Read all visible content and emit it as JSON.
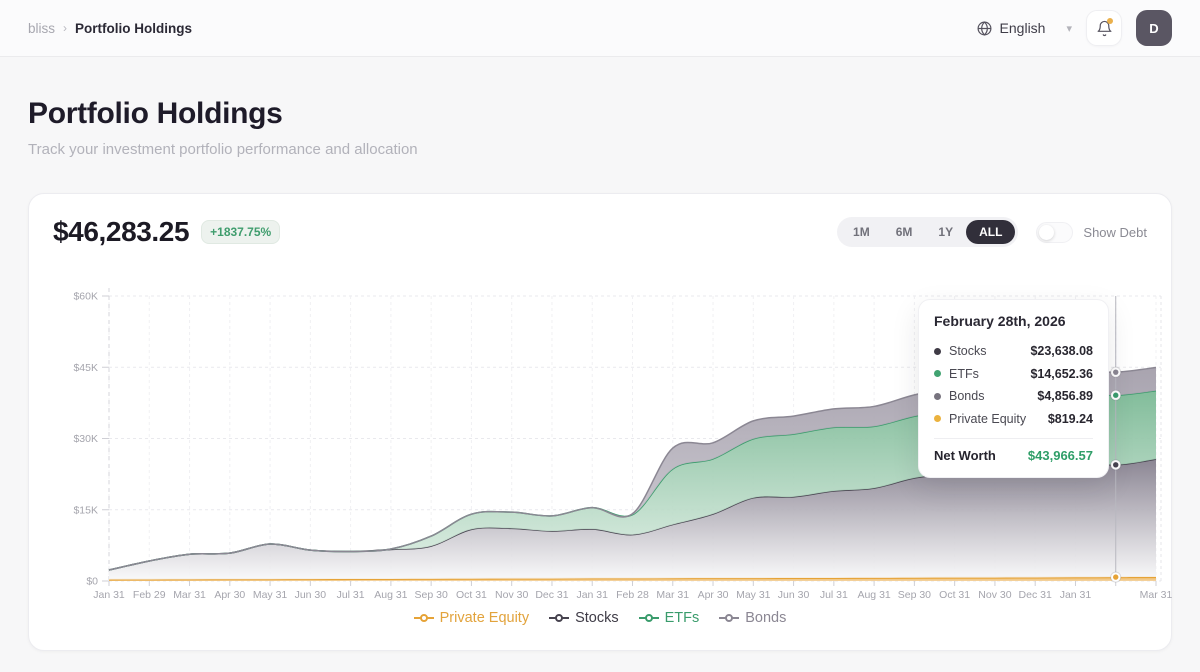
{
  "topbar": {
    "breadcrumb": {
      "root": "bliss",
      "separator": "›",
      "current": "Portfolio Holdings"
    },
    "language": "English",
    "avatar_initial": "D"
  },
  "page": {
    "title": "Portfolio Holdings",
    "subtitle": "Track your investment portfolio performance and allocation"
  },
  "card": {
    "net_worth": "$46,283.25",
    "change_badge": "+1837.75%",
    "ranges": [
      "1M",
      "6M",
      "1Y",
      "ALL"
    ],
    "active_range": "ALL",
    "show_debt_label": "Show Debt"
  },
  "tooltip": {
    "title": "February 28th, 2026",
    "rows": [
      {
        "label": "Stocks",
        "value": "$23,638.08",
        "color": "#3f3b46"
      },
      {
        "label": "ETFs",
        "value": "$14,652.36",
        "color": "#41a371"
      },
      {
        "label": "Bonds",
        "value": "$4,856.89",
        "color": "#77737e"
      },
      {
        "label": "Private Equity",
        "value": "$819.24",
        "color": "#ebb23e"
      }
    ],
    "net_worth_label": "Net Worth",
    "net_worth_value": "$43,966.57"
  },
  "chart_data": {
    "type": "area",
    "stacked": true,
    "x_labels": [
      "Jan 31",
      "Feb 29",
      "Mar 31",
      "Apr 30",
      "May 31",
      "Jun 30",
      "Jul 31",
      "Aug 31",
      "Sep 30",
      "Oct 31",
      "Nov 30",
      "Dec 31",
      "Jan 31",
      "Feb 28",
      "Mar 31",
      "Apr 30",
      "May 31",
      "Jun 30",
      "Jul 31",
      "Aug 31",
      "Sep 30",
      "Oct 31",
      "Nov 30",
      "Dec 31",
      "Jan 31",
      "Feb 28",
      "Mar 31"
    ],
    "hidden_x_label_index": 25,
    "highlight_index": 25,
    "ylim": [
      0,
      60000
    ],
    "y_ticks": [
      {
        "value": 0,
        "label": "$0"
      },
      {
        "value": 15000,
        "label": "$15K"
      },
      {
        "value": 30000,
        "label": "$30K"
      },
      {
        "value": 45000,
        "label": "$45K"
      },
      {
        "value": 60000,
        "label": "$60K"
      }
    ],
    "grid": true,
    "legend_position": "bottom",
    "series": [
      {
        "key": "private_equity",
        "name": "Private Equity",
        "stroke": "#e6a337",
        "fill_top": "#ecb254",
        "fill_bottom": "#f3cf97",
        "text_color": "#e2a33c",
        "values": [
          300,
          320,
          340,
          360,
          380,
          400,
          410,
          430,
          450,
          470,
          490,
          510,
          540,
          550,
          580,
          600,
          610,
          620,
          640,
          650,
          680,
          700,
          720,
          750,
          780,
          819.24,
          850
        ]
      },
      {
        "key": "stocks",
        "name": "Stocks",
        "stroke": "#47434f",
        "fill_top": "#847e8d",
        "fill_bottom": "#f8f8f9",
        "text_color": "#3f3c47",
        "values": [
          2000,
          3900,
          5300,
          5500,
          7400,
          6100,
          5800,
          6200,
          6900,
          10400,
          10600,
          10000,
          10400,
          9200,
          11300,
          13500,
          16900,
          17100,
          18300,
          18900,
          21000,
          22000,
          23300,
          25000,
          24500,
          23638.08,
          24800
        ]
      },
      {
        "key": "etfs",
        "name": "ETFs",
        "stroke": "#3a9c6c",
        "fill_top": "#7bb995",
        "fill_bottom": "#dcede2",
        "text_color": "#3a9c6c",
        "values": [
          0,
          0,
          0,
          0,
          0,
          0,
          0,
          100,
          2100,
          3200,
          3400,
          3200,
          4500,
          4200,
          11700,
          11600,
          12400,
          13200,
          13400,
          13000,
          13000,
          13500,
          13800,
          13600,
          14200,
          14652.36,
          14400
        ]
      },
      {
        "key": "bonds",
        "name": "Bonds",
        "stroke": "#8b8793",
        "fill_top": "#a49fab",
        "fill_bottom": "#cfccd4",
        "text_color": "#8b8793",
        "values": [
          0,
          0,
          0,
          0,
          0,
          0,
          0,
          0,
          0,
          0,
          0,
          0,
          0,
          200,
          4400,
          3400,
          3800,
          3800,
          3900,
          4200,
          4500,
          4600,
          4700,
          4700,
          4900,
          4856.89,
          4900
        ]
      }
    ],
    "legend_order": [
      "private_equity",
      "stocks",
      "etfs",
      "bonds"
    ]
  }
}
